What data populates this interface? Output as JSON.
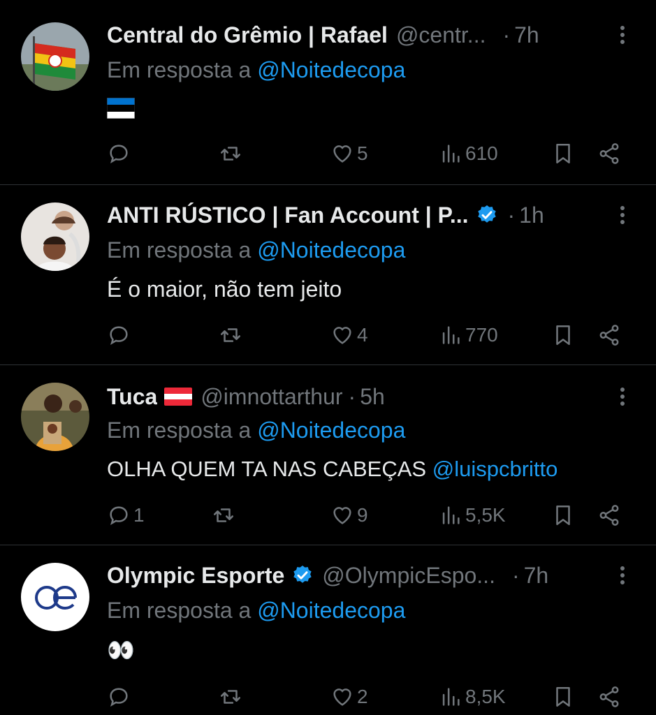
{
  "tweets": [
    {
      "name": "Central do Grêmio | Rafael",
      "handle": "@centr...",
      "time": "7h",
      "reply_prefix": "Em resposta a",
      "reply_to": "@Noitedecopa",
      "text": "",
      "text_emoji": "estonia-flag",
      "replies": "",
      "retweets": "",
      "likes": "5",
      "views": "610",
      "avatar_icon": "rio-grande-do-sul-flag-avatar"
    },
    {
      "name": "ANTI RÚSTICO | Fan Account | P...",
      "handle": "",
      "verified": true,
      "time": "1h",
      "reply_prefix": "Em resposta a",
      "reply_to": "@Noitedecopa",
      "text": "É o maior, não tem jeito",
      "replies": "",
      "retweets": "",
      "likes": "4",
      "views": "770",
      "avatar_icon": "two-people-photo-avatar"
    },
    {
      "name": "Tuca",
      "name_flag": "austria-flag",
      "handle": "@imnottarthur",
      "time": "5h",
      "reply_prefix": "Em resposta a",
      "reply_to": "@Noitedecopa",
      "text": "OLHA QUEM TA NAS CABEÇAS",
      "text_mention": "@luispcbritto",
      "replies": "1",
      "retweets": "",
      "likes": "9",
      "views": "5,5K",
      "avatar_icon": "person-photo-avatar"
    },
    {
      "name": "Olympic Esporte",
      "handle": "@OlympicEspo...",
      "verified": true,
      "time": "7h",
      "reply_prefix": "Em resposta a",
      "reply_to": "@Noitedecopa",
      "text": "👀",
      "replies": "",
      "retweets": "",
      "likes": "2",
      "views": "8,5K",
      "avatar_icon": "oe-logo-avatar"
    }
  ],
  "separator": "·",
  "colors": {
    "background": "#000000",
    "text": "#e7e9ea",
    "muted": "#71767b",
    "accent": "#1d9bf0",
    "divider": "#2f3336"
  }
}
